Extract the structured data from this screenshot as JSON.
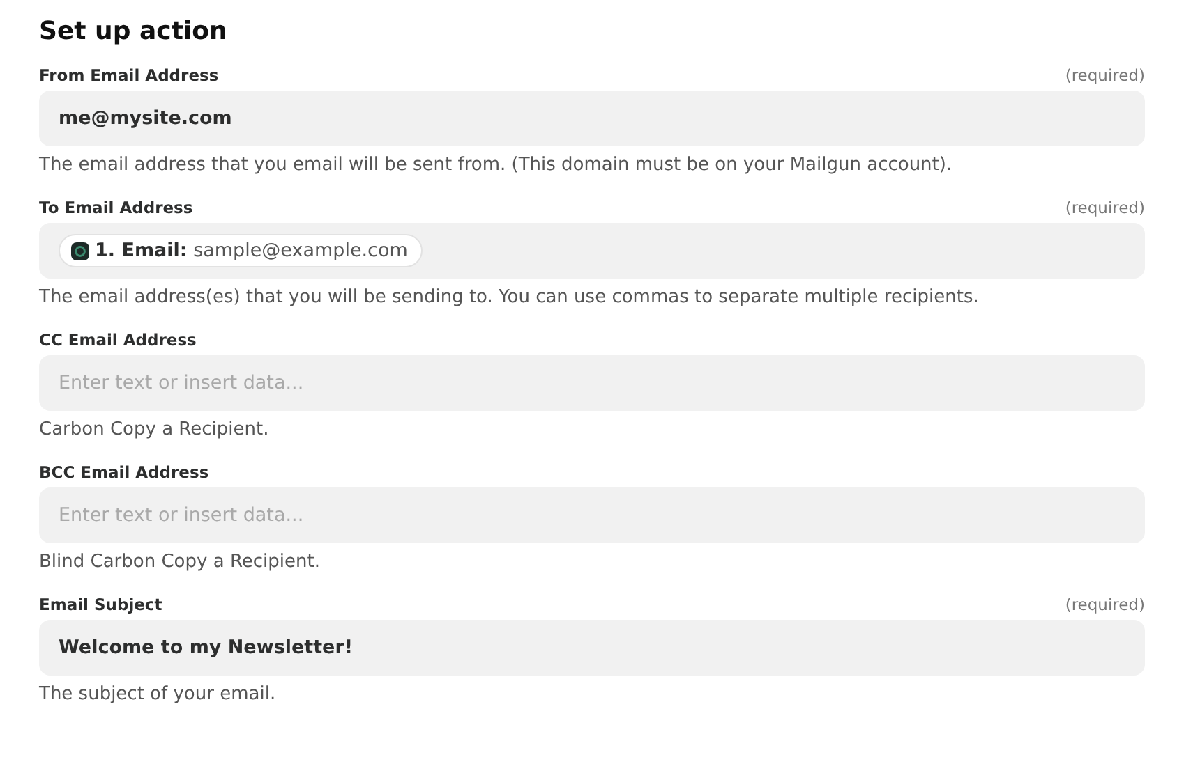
{
  "title": "Set up action",
  "fields": [
    {
      "label": "From Email Address",
      "required": "(required)",
      "kind": "text",
      "value": "me@mysite.com",
      "help": "The email address that you email will be sent from. (This domain must be on your Mailgun account)."
    },
    {
      "label": "To Email Address",
      "required": "(required)",
      "kind": "pill",
      "pill": {
        "label": "1. Email:",
        "value": "sample@example.com"
      },
      "help": "The email address(es) that you will be sending to. You can use commas to separate multiple recipients."
    },
    {
      "label": "CC Email Address",
      "kind": "empty",
      "placeholder": "Enter text or insert data...",
      "help": "Carbon Copy a Recipient."
    },
    {
      "label": "BCC Email Address",
      "kind": "empty",
      "placeholder": "Enter text or insert data...",
      "help": "Blind Carbon Copy a Recipient."
    },
    {
      "label": "Email Subject",
      "required": "(required)",
      "kind": "text",
      "value": "Welcome to my Newsletter!",
      "help": "The subject of your email."
    }
  ]
}
